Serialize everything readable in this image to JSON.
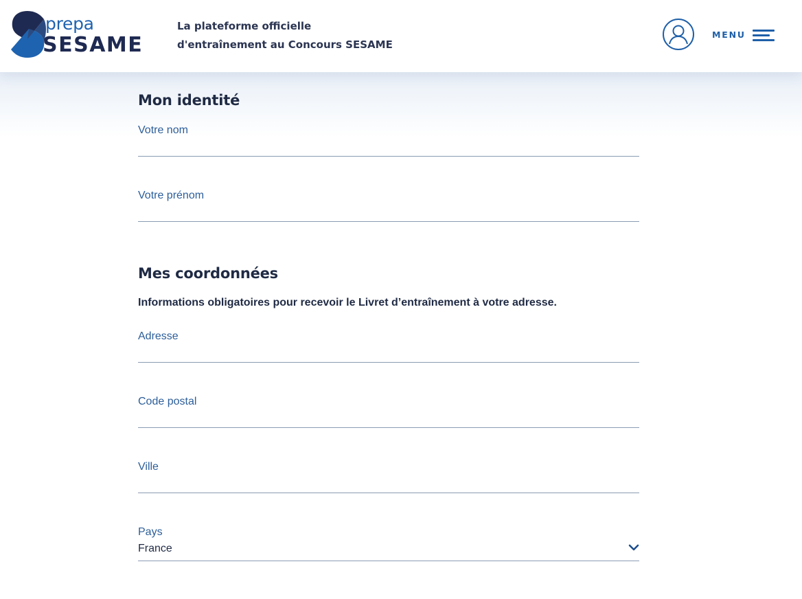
{
  "brand": {
    "prefix": "prepa",
    "name": "SESAME"
  },
  "header": {
    "tagline_line1": "La plateforme officielle",
    "tagline_line2": "d'entraînement au Concours SESAME",
    "menu_label": "MENU",
    "user_icon": "user-icon",
    "menu_icon": "hamburger-icon"
  },
  "identity": {
    "title": "Mon identité",
    "nom_label": "Votre nom",
    "nom_value": "",
    "prenom_label": "Votre prénom",
    "prenom_value": ""
  },
  "coordinates": {
    "title": "Mes coordonnées",
    "note": "Informations obligatoires pour recevoir le Livret d’entraînement à votre adresse.",
    "adresse_label": "Adresse",
    "adresse_value": "",
    "code_postal_label": "Code postal",
    "code_postal_value": "",
    "ville_label": "Ville",
    "ville_value": "",
    "pays_label": "Pays",
    "pays_value": "France"
  },
  "colors": {
    "brand_dark": "#1f2a52",
    "brand_blue": "#1e63b0",
    "label_blue": "#2c5e99",
    "underline": "#8a9bb3"
  }
}
